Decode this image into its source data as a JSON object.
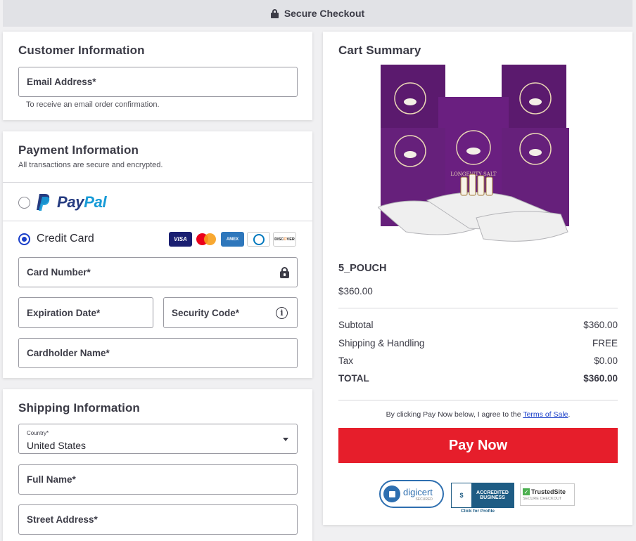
{
  "topbar": {
    "title": "Secure Checkout"
  },
  "customer": {
    "title": "Customer Information",
    "email_label": "Email Address*",
    "email_hint": "To receive an email order confirmation."
  },
  "payment": {
    "title": "Payment Information",
    "subtitle": "All transactions are secure and encrypted.",
    "paypal_label_pay": "Pay",
    "paypal_label_pal": "Pal",
    "credit_card_label": "Credit Card",
    "card_brands": [
      "VISA",
      "Mastercard",
      "AMEX",
      "Diners Club",
      "DISCOVER"
    ],
    "card_number_label": "Card Number*",
    "expiration_label": "Expiration Date*",
    "security_code_label": "Security Code*",
    "cardholder_label": "Cardholder Name*",
    "selected_method": "credit-card"
  },
  "shipping": {
    "title": "Shipping Information",
    "country_label": "Country*",
    "country_value": "United States",
    "full_name_label": "Full Name*",
    "street_label": "Street Address*"
  },
  "cart": {
    "title": "Cart Summary",
    "product_image_text": "LONGEVITY SALT",
    "product_name": "5_POUCH",
    "product_price": "$360.00",
    "rows": [
      {
        "label": "Subtotal",
        "value": "$360.00"
      },
      {
        "label": "Shipping & Handling",
        "value": "FREE"
      },
      {
        "label": "Tax",
        "value": "$0.00"
      }
    ],
    "total_label": "TOTAL",
    "total_value": "$360.00",
    "terms_prefix": "By clicking Pay Now below, I agree to the ",
    "terms_link": "Terms of Sale",
    "terms_suffix": ".",
    "pay_button": "Pay Now",
    "badges": {
      "digicert": "digicert",
      "digicert_sub": "SECURED",
      "bbb_line1": "ACCREDITED",
      "bbb_line2": "BUSINESS",
      "bbb_profile": "Click for Profile",
      "trusted_title": "TrustedSite",
      "trusted_sub": "SECURE CHECKOUT"
    }
  },
  "colors": {
    "accent": "#1a3fc9",
    "pay_button": "#e61e2b",
    "link": "#1a3fc9"
  }
}
